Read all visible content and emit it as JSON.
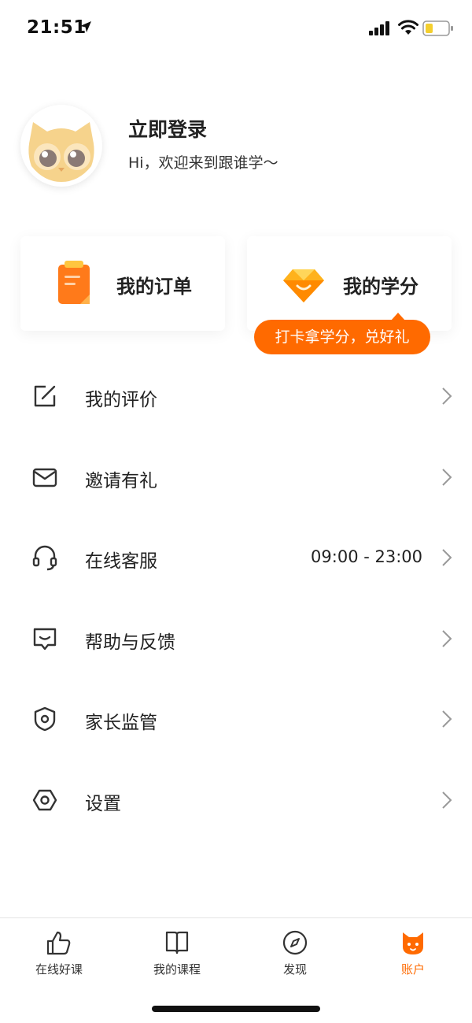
{
  "status_bar": {
    "time": "21:51"
  },
  "profile": {
    "title": "立即登录",
    "subtitle": "Hi，欢迎来到跟谁学～"
  },
  "cards": {
    "orders_label": "我的订单",
    "credits_label": "我的学分",
    "tooltip": "打卡拿学分，兑好礼"
  },
  "menu": {
    "items": [
      {
        "label": "我的评价",
        "icon": "edit-icon"
      },
      {
        "label": "邀请有礼",
        "icon": "envelope-icon"
      },
      {
        "label": "在线客服",
        "icon": "headset-icon",
        "extra": "09:00 - 23:00"
      },
      {
        "label": "帮助与反馈",
        "icon": "feedback-icon"
      },
      {
        "label": "家长监管",
        "icon": "shield-icon"
      },
      {
        "label": "设置",
        "icon": "settings-icon"
      }
    ]
  },
  "tab_bar": {
    "tabs": [
      {
        "label": "在线好课",
        "icon": "thumbs-up-icon"
      },
      {
        "label": "我的课程",
        "icon": "book-icon"
      },
      {
        "label": "发现",
        "icon": "compass-icon"
      },
      {
        "label": "账户",
        "icon": "cat-icon",
        "active": true
      }
    ]
  },
  "colors": {
    "accent": "#ff6a00",
    "text": "#222222",
    "divider": "#e4e4e4"
  }
}
